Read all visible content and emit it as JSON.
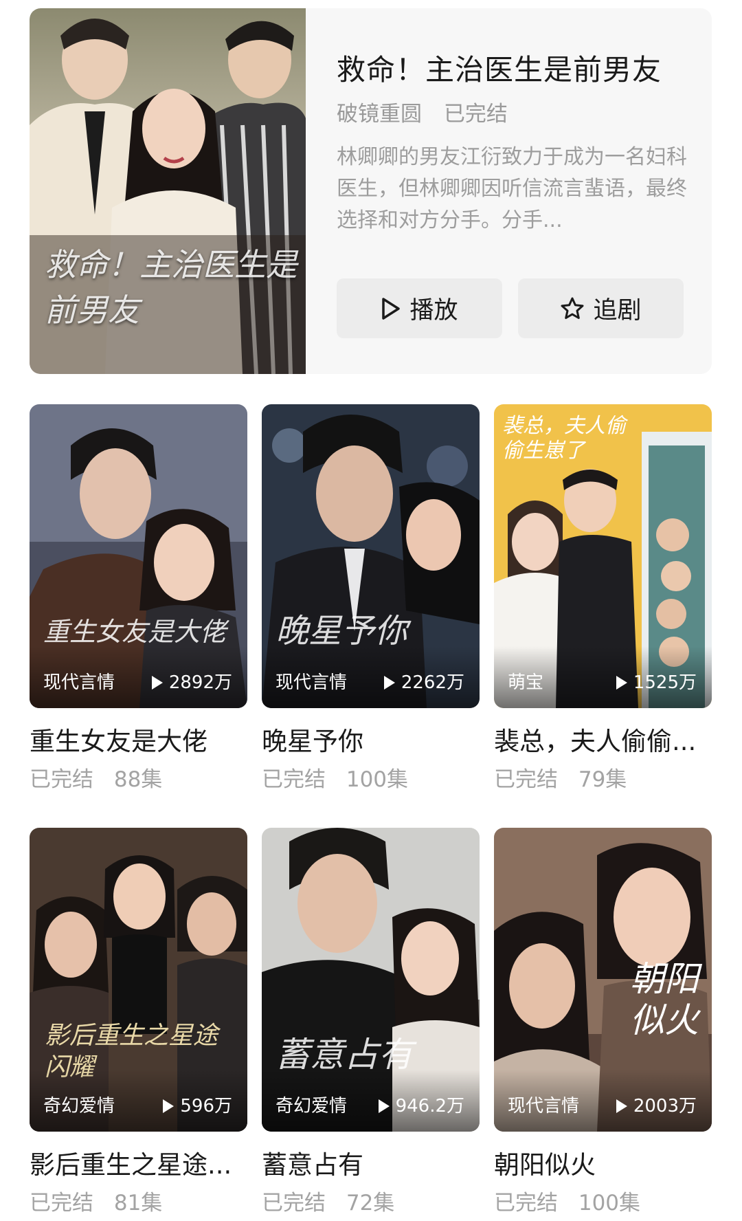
{
  "featured": {
    "title": "救命！主治医生是前男友",
    "genre": "破镜重圆",
    "status": "已完结",
    "description": "林卿卿的男友江衍致力于成为一名妇科医生，但林卿卿因听信流言蜚语，最终选择和对方分手。分手...",
    "poster_caption": "救命！主治医生是前男友",
    "play_label": "播放",
    "follow_label": "追剧"
  },
  "dramas": [
    {
      "title": "重生女友是大佬",
      "tag": "现代言情",
      "views": "2892万",
      "status": "已完结",
      "episodes": "88集",
      "poster_caption": "重生女友是大佬"
    },
    {
      "title": "晚星予你",
      "tag": "现代言情",
      "views": "2262万",
      "status": "已完结",
      "episodes": "100集",
      "poster_caption": "晚星予你"
    },
    {
      "title": "裴总，夫人偷偷...",
      "tag": "萌宝",
      "views": "1525万",
      "status": "已完结",
      "episodes": "79集",
      "poster_caption": "裴总，夫人偷偷生崽了"
    },
    {
      "title": "影后重生之星途...",
      "tag": "奇幻爱情",
      "views": "596万",
      "status": "已完结",
      "episodes": "81集",
      "poster_caption": "影后重生之星途闪耀"
    },
    {
      "title": "蓄意占有",
      "tag": "奇幻爱情",
      "views": "946.2万",
      "status": "已完结",
      "episodes": "72集",
      "poster_caption": "蓄意占有"
    },
    {
      "title": "朝阳似火",
      "tag": "现代言情",
      "views": "2003万",
      "status": "已完结",
      "episodes": "100集",
      "poster_caption": "朝阳似火"
    }
  ],
  "colors": {
    "card_bg": "#f7f7f7",
    "button_bg": "#ececec",
    "muted_text": "#9a9a9a"
  }
}
